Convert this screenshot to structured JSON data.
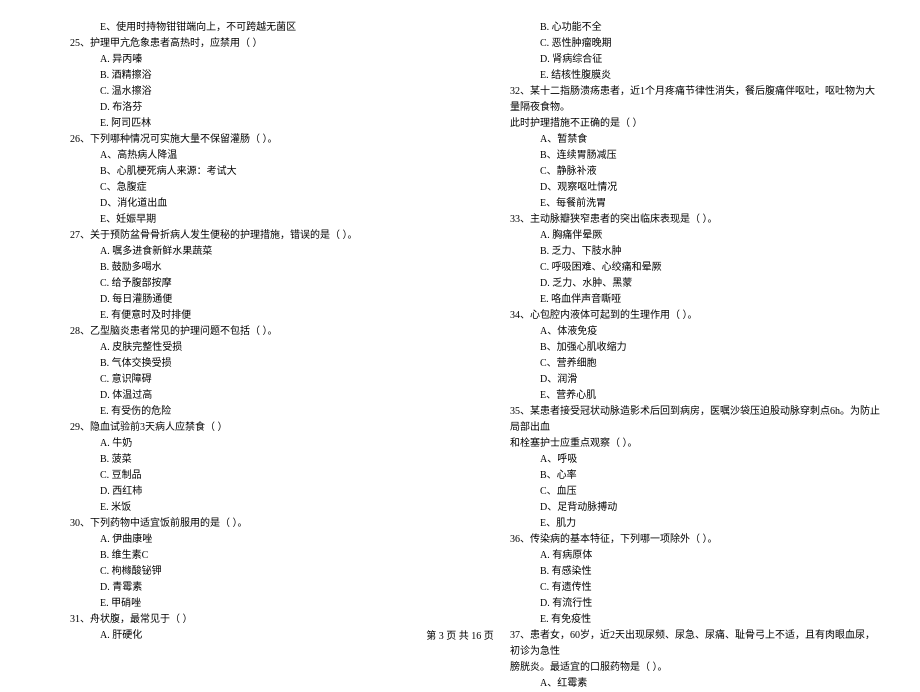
{
  "footer": {
    "text": "第 3 页  共 16 页"
  },
  "left": {
    "q24_E": "E、使用时持物钳钳端向上，不可跨越无菌区",
    "q25": "25、护理甲亢危象患者高热时，应禁用（      ）",
    "q25_A": "A. 异丙嗪",
    "q25_B": "B. 酒精擦浴",
    "q25_C": "C. 温水擦浴",
    "q25_D": "D. 布洛芬",
    "q25_E": "E. 阿司匹林",
    "q26": "26、下列哪种情况可实施大量不保留灌肠（      ）。",
    "q26_A": "A、高热病人降温",
    "q26_B": "B、心肌梗死病人来源：考试大",
    "q26_C": "C、急腹症",
    "q26_D": "D、消化道出血",
    "q26_E": "E、妊娠早期",
    "q27": "27、关于预防盆骨骨折病人发生便秘的护理措施，错误的是（      ）。",
    "q27_A": "A. 嘱多进食新鲜水果蔬菜",
    "q27_B": "B. 鼓励多喝水",
    "q27_C": "C. 给予腹部按摩",
    "q27_D": "D. 每日灌肠通便",
    "q27_E": "E. 有便意时及时排便",
    "q28": "28、乙型脑炎患者常见的护理问题不包括（      ）。",
    "q28_A": "A. 皮肤完整性受损",
    "q28_B": "B. 气体交换受损",
    "q28_C": "C. 意识障碍",
    "q28_D": "D. 体温过高",
    "q28_E": "E. 有受伤的危险",
    "q29": "29、隐血试验前3天病人应禁食（      ）",
    "q29_A": "A. 牛奶",
    "q29_B": "B. 菠菜",
    "q29_C": "C. 豆制品",
    "q29_D": "D. 西红柿",
    "q29_E": "E. 米饭",
    "q30": "30、下列药物中适宜饭前服用的是（      ）。",
    "q30_A": "A. 伊曲康唑",
    "q30_B": "B. 维生素C",
    "q30_C": "C. 枸橼酸铋钾",
    "q30_D": "D. 青霉素",
    "q30_E": "E. 甲硝唑",
    "q31": "31、舟状腹，最常见于（      ）",
    "q31_A": "A. 肝硬化"
  },
  "right": {
    "q31_B": "B. 心功能不全",
    "q31_C": "C. 恶性肿瘤晚期",
    "q31_D": "D. 肾病综合征",
    "q31_E": "E. 结核性腹膜炎",
    "q32": "32、某十二指肠溃疡患者，近1个月疼痛节律性消失，餐后腹痛伴呕吐，呕吐物为大量隔夜食物。",
    "q32_cont": "此时护理措施不正确的是（      ）",
    "q32_A": "A、暂禁食",
    "q32_B": "B、连续胃肠减压",
    "q32_C": "C、静脉补液",
    "q32_D": "D、观察呕吐情况",
    "q32_E": "E、每餐前洗胃",
    "q33": "33、主动脉瓣狭窄患者的突出临床表现是（      ）。",
    "q33_A": "A. 胸痛伴晕厥",
    "q33_B": "B. 乏力、下肢水肿",
    "q33_C": "C. 呼吸困难、心绞痛和晕厥",
    "q33_D": "D. 乏力、水肿、黑蒙",
    "q33_E": "E. 咯血伴声音嘶哑",
    "q34": "34、心包腔内液体可起到的生理作用（      ）。",
    "q34_A": "A、体液免疫",
    "q34_B": "B、加强心肌收缩力",
    "q34_C": "C、营养细胞",
    "q34_D": "D、润滑",
    "q34_E": "E、营养心肌",
    "q35": "35、某患者接受冠状动脉造影术后回到病房，医嘱沙袋压迫股动脉穿刺点6h。为防止局部出血",
    "q35_cont": "和栓塞护士应重点观察（      ）。",
    "q35_A": "A、呼吸",
    "q35_B": "B、心率",
    "q35_C": "C、血压",
    "q35_D": "D、足背动脉搏动",
    "q35_E": "E、肌力",
    "q36": "36、传染病的基本特征，下列哪一项除外（      ）。",
    "q36_A": "A. 有病原体",
    "q36_B": "B. 有感染性",
    "q36_C": "C. 有遗传性",
    "q36_D": "D. 有流行性",
    "q36_E": "E. 有免疫性",
    "q37": "37、患者女，60岁，近2天出现尿频、尿急、尿痛、耻骨弓上不适，且有肉眼血尿，初诊为急性",
    "q37_cont": "膀胱炎。最适宜的口服药物是（      ）。",
    "q37_A": "A、红霉素"
  }
}
